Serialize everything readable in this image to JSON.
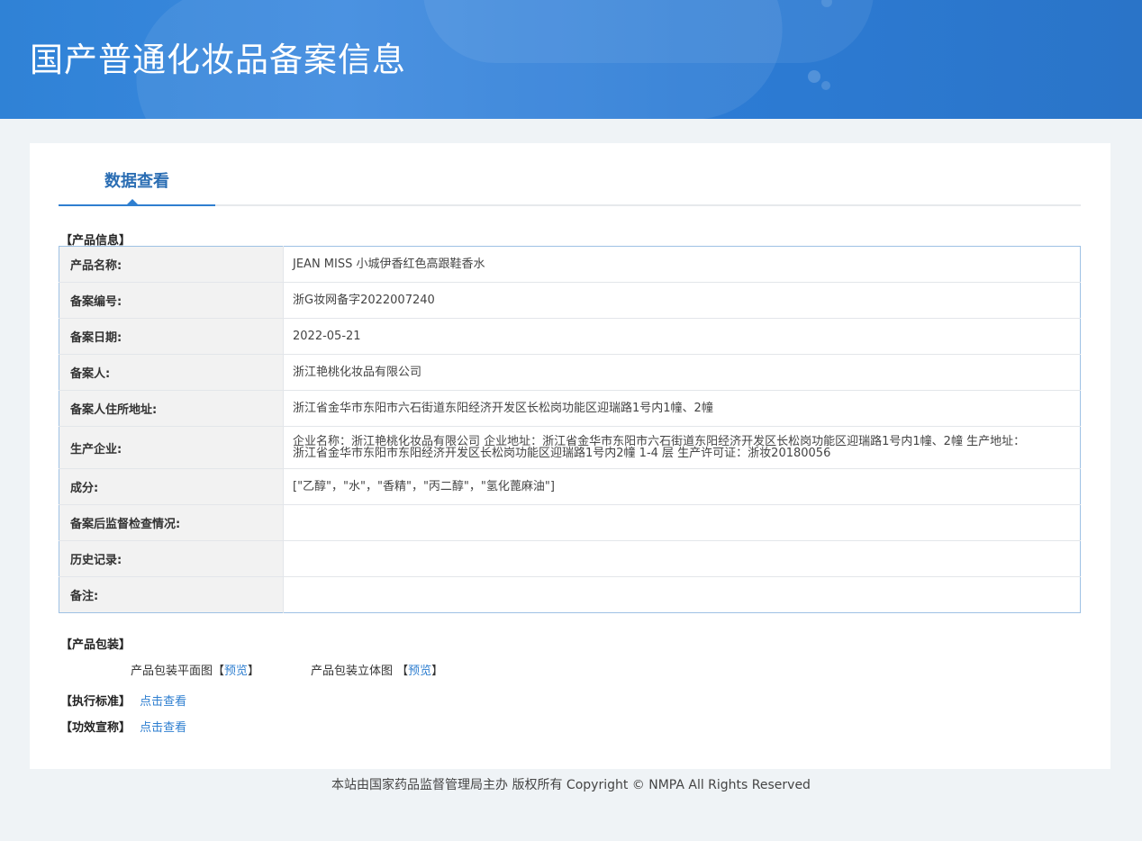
{
  "header": {
    "title": "国产普通化妆品备案信息"
  },
  "tabs": [
    {
      "label": "数据查看"
    }
  ],
  "sections": {
    "product_info": "【产品信息】",
    "packaging": "【产品包装】",
    "standard": "【执行标准】",
    "efficacy": "【功效宣称】"
  },
  "product_info_rows": [
    {
      "label": "产品名称:",
      "value": "JEAN MISS 小城伊香红色高跟鞋香水"
    },
    {
      "label": "备案编号:",
      "value": "浙G妆网备字2022007240"
    },
    {
      "label": "备案日期:",
      "value": "2022-05-21"
    },
    {
      "label": "备案人:",
      "value": "浙江艳桃化妆品有限公司"
    },
    {
      "label": "备案人住所地址:",
      "value": "浙江省金华市东阳市六石街道东阳经济开发区长松岗功能区迎瑞路1号内1幢、2幢"
    },
    {
      "label": "生产企业:",
      "value": "企业名称：浙江艳桃化妆品有限公司 企业地址：浙江省金华市东阳市六石街道东阳经济开发区长松岗功能区迎瑞路1号内1幢、2幢 生产地址：浙江省金华市东阳市东阳经济开发区长松岗功能区迎瑞路1号内2幢 1-4 层 生产许可证：浙妆20180056"
    },
    {
      "label": "成分:",
      "value": "[\"乙醇\"，\"水\"，\"香精\"，\"丙二醇\"，\"氢化蓖麻油\"]"
    },
    {
      "label": "备案后监督检查情况:",
      "value": ""
    },
    {
      "label": "历史记录:",
      "value": ""
    },
    {
      "label": "备注:",
      "value": ""
    }
  ],
  "packaging": {
    "flat_label": "产品包装平面图",
    "flat_link": "预览",
    "threed_label": "产品包装立体图 ",
    "threed_link": "预览",
    "bracket_open": "【",
    "bracket_close": "】"
  },
  "standard_link": "点击查看",
  "efficacy_link": "点击查看",
  "footer": "本站由国家药品监督管理局主办 版权所有 Copyright © NMPA All Rights Reserved"
}
